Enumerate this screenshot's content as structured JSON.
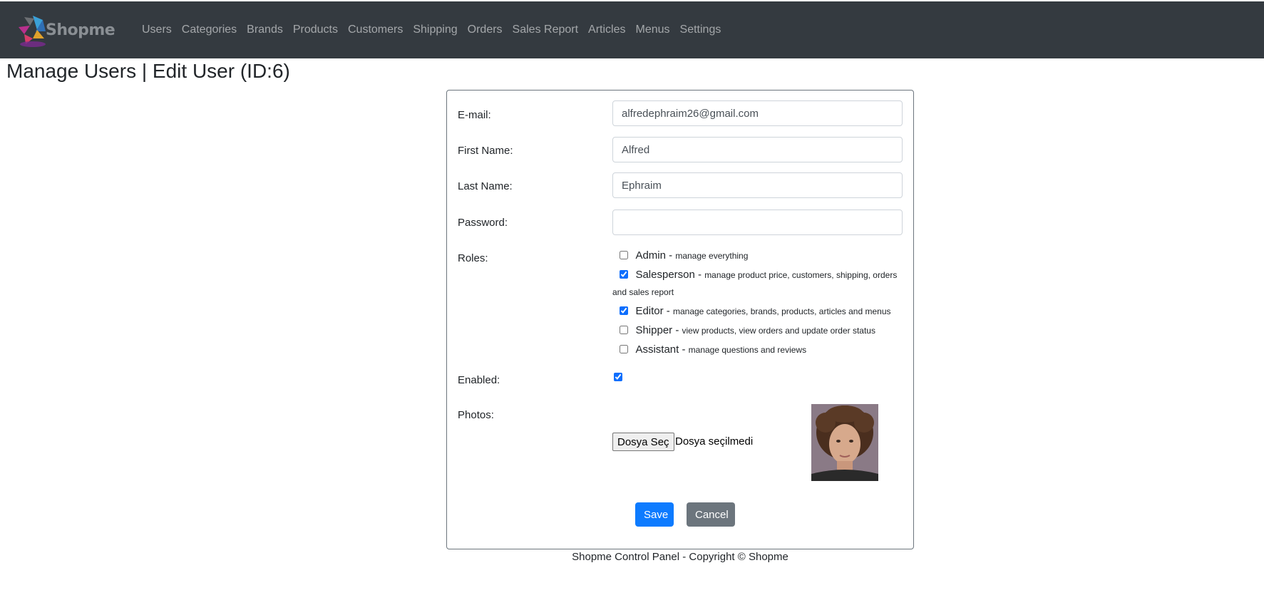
{
  "nav": {
    "brand": "Shopme",
    "links": [
      "Users",
      "Categories",
      "Brands",
      "Products",
      "Customers",
      "Shipping",
      "Orders",
      "Sales Report",
      "Articles",
      "Menus",
      "Settings"
    ]
  },
  "page_title": "Manage Users | Edit User (ID:6)",
  "form": {
    "email_label": "E-mail:",
    "email_value": "alfredephraim26@gmail.com",
    "first_name_label": "First Name:",
    "first_name_value": "Alfred",
    "last_name_label": "Last Name:",
    "last_name_value": "Ephraim",
    "password_label": "Password:",
    "password_value": "",
    "roles_label": "Roles:",
    "roles": [
      {
        "name": "Admin",
        "description": "manage everything",
        "checked": false
      },
      {
        "name": "Salesperson",
        "description": "manage product price, customers, shipping, orders and sales report",
        "checked": true
      },
      {
        "name": "Editor",
        "description": "manage categories, brands, products, articles and menus",
        "checked": true
      },
      {
        "name": "Shipper",
        "description": "view products, view orders and update order status",
        "checked": false
      },
      {
        "name": "Assistant",
        "description": "manage questions and reviews",
        "checked": false
      }
    ],
    "enabled_label": "Enabled:",
    "enabled": true,
    "photos_label": "Photos:",
    "file_button": "Dosya Seç",
    "file_status": "Dosya seçilmedi",
    "save_label": "Save",
    "cancel_label": "Cancel"
  },
  "footer": "Shopme Control Panel - Copyright © Shopme",
  "colors": {
    "navbar": "#343a40",
    "primary": "#0d7bff",
    "secondary": "#6c757d"
  }
}
